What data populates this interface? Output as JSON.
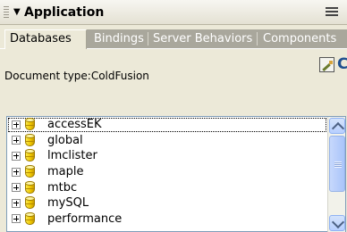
{
  "panel": {
    "title": "Application",
    "collapse_icon": "triangle-down-icon",
    "options_icon": "panel-options-icon"
  },
  "tabs": [
    {
      "label": "Databases",
      "selected": true
    },
    {
      "label": "Bindings",
      "selected": false
    },
    {
      "label": "Server Behaviors",
      "selected": false
    },
    {
      "label": "Components",
      "selected": false
    }
  ],
  "toolbar": {
    "document_type": "Document type:ColdFusion",
    "edit_icon": "edit-icon",
    "refresh_icon": "refresh-icon"
  },
  "tree": {
    "items": [
      {
        "label": "accessEK",
        "selected": true
      },
      {
        "label": "global",
        "selected": false
      },
      {
        "label": "lmclister",
        "selected": false
      },
      {
        "label": "maple",
        "selected": false
      },
      {
        "label": "mtbc",
        "selected": false
      },
      {
        "label": "mySQL",
        "selected": false
      },
      {
        "label": "performance",
        "selected": false
      }
    ]
  },
  "colors": {
    "panel_bg": "#ece9d8",
    "inactive_tab_strip": "#a9a79c",
    "scrollbar_accent": "#b7cfff",
    "database_icon": "#f0c800"
  }
}
